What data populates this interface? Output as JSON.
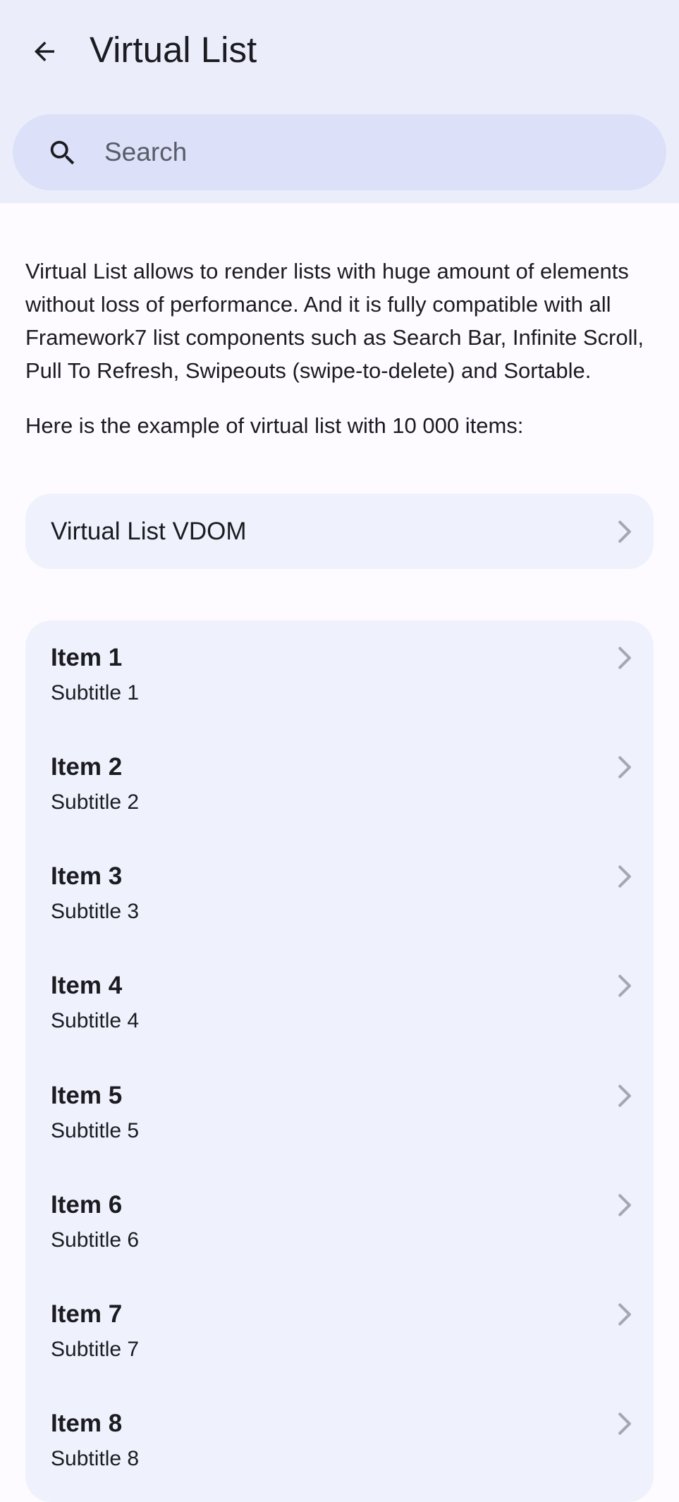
{
  "navbar": {
    "back_icon": "arrow-left-icon",
    "title": "Virtual List"
  },
  "search": {
    "icon": "search-icon",
    "placeholder": "Search",
    "value": ""
  },
  "intro": {
    "paragraph1": "Virtual List allows to render lists with huge amount of elements without loss of performance. And it is fully compatible with all Framework7 list components such as Search Bar, Infinite Scroll, Pull To Refresh, Swipeouts (swipe-to-delete) and Sortable.",
    "paragraph2": "Here is the example of virtual list with 10 000 items:"
  },
  "vdom_link": {
    "label": "Virtual List VDOM",
    "icon": "chevron-right-icon"
  },
  "items": [
    {
      "title": "Item 1",
      "subtitle": "Subtitle 1"
    },
    {
      "title": "Item 2",
      "subtitle": "Subtitle 2"
    },
    {
      "title": "Item 3",
      "subtitle": "Subtitle 3"
    },
    {
      "title": "Item 4",
      "subtitle": "Subtitle 4"
    },
    {
      "title": "Item 5",
      "subtitle": "Subtitle 5"
    },
    {
      "title": "Item 6",
      "subtitle": "Subtitle 6"
    },
    {
      "title": "Item 7",
      "subtitle": "Subtitle 7"
    },
    {
      "title": "Item 8",
      "subtitle": "Subtitle 8"
    }
  ],
  "colors": {
    "navbar_bg": "#ebeefa",
    "search_bg": "#dce1f9",
    "list_bg": "#eff2fc",
    "page_bg": "#fdfbff",
    "text": "#1b1b21",
    "chevron": "#a5a8b4"
  }
}
